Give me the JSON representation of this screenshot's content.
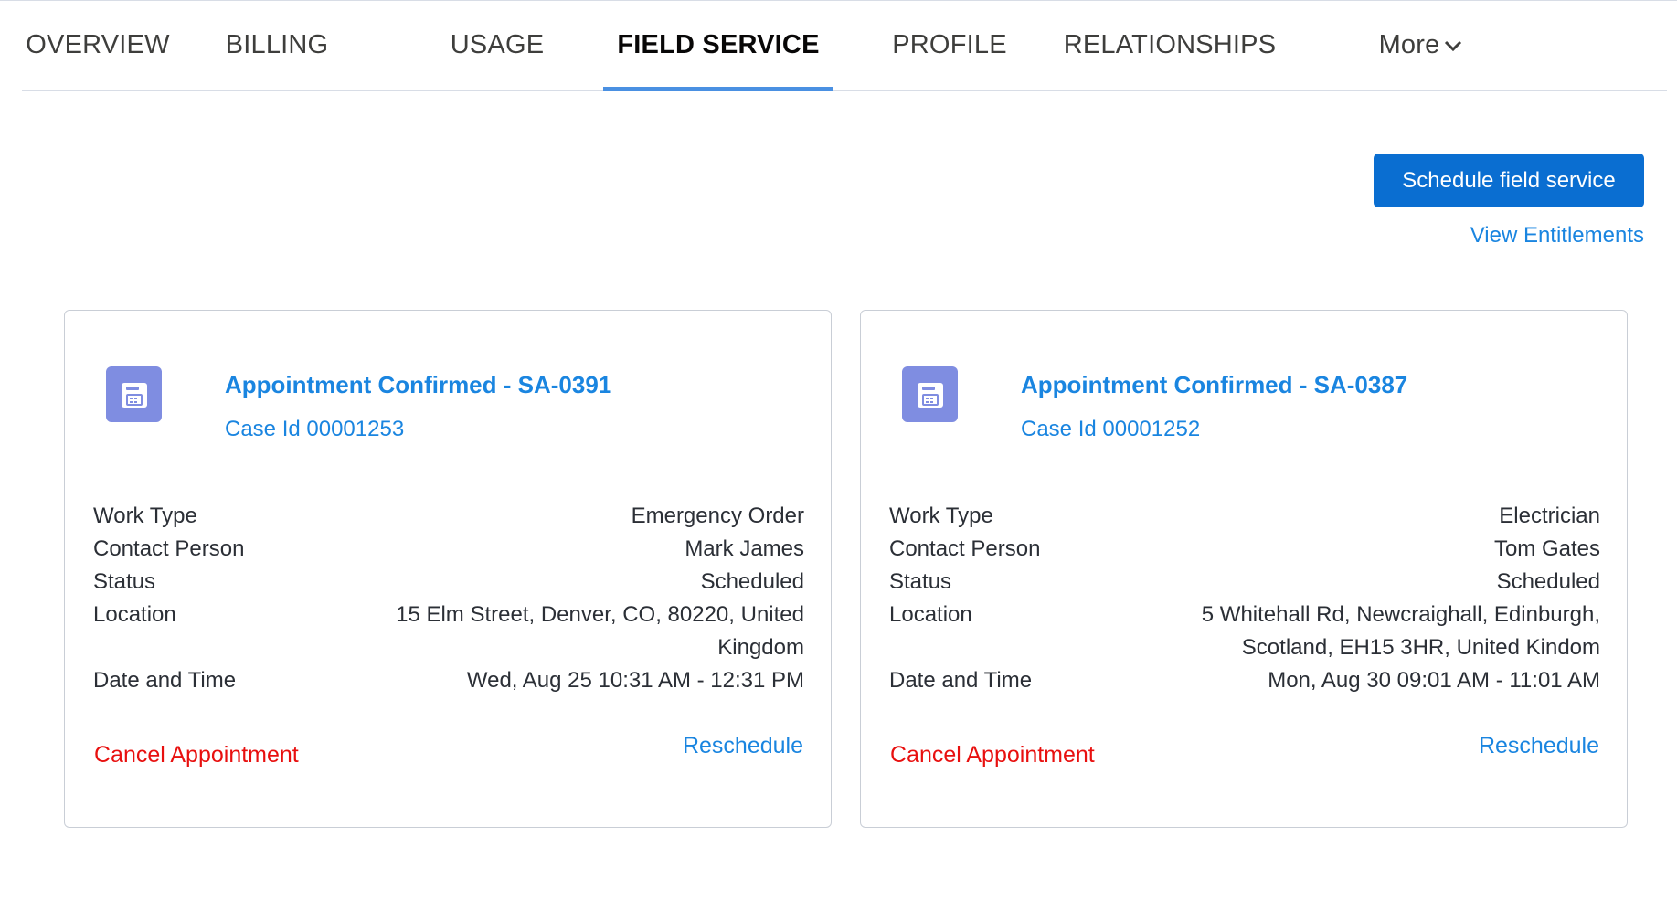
{
  "tabs": [
    {
      "label": "OVERVIEW"
    },
    {
      "label": "BILLING"
    },
    {
      "label": "USAGE"
    },
    {
      "label": "FIELD SERVICE",
      "active": true
    },
    {
      "label": "PROFILE"
    },
    {
      "label": "RELATIONSHIPS"
    }
  ],
  "more_label": "More",
  "actions": {
    "schedule_label": "Schedule field service",
    "entitlements_label": "View Entitlements"
  },
  "field_labels": {
    "work_type": "Work Type",
    "contact_person": "Contact Person",
    "status": "Status",
    "location": "Location",
    "date_time": "Date and Time"
  },
  "appointments": [
    {
      "title": "Appointment Confirmed - SA-0391",
      "case": "Case Id 00001253",
      "work_type": "Emergency Order",
      "contact_person": "Mark James",
      "status": "Scheduled",
      "location": "15 Elm Street, Denver, CO, 80220, United Kingdom",
      "date_time": "Wed, Aug 25 10:31 AM - 12:31 PM",
      "cancel_label": "Cancel Appointment",
      "reschedule_label": "Reschedule"
    },
    {
      "title": "Appointment Confirmed - SA-0387",
      "case": "Case Id 00001252",
      "work_type": "Electrician",
      "contact_person": "Tom Gates",
      "status": "Scheduled",
      "location": "5 Whitehall Rd, Newcraighall, Edinburgh, Scotland, EH15 3HR, United Kindom",
      "date_time": "Mon, Aug 30 09:01 AM - 11:01 AM",
      "cancel_label": "Cancel Appointment",
      "reschedule_label": "Reschedule"
    }
  ],
  "icons": {
    "appointment": "calendar-icon",
    "more": "chevron-down-icon"
  },
  "colors": {
    "primary": "#0a6ed1",
    "link": "#1a85e0",
    "danger": "#e8100f",
    "active_tab_underline": "#4a90e2",
    "icon_bg": "#7f8de1"
  }
}
